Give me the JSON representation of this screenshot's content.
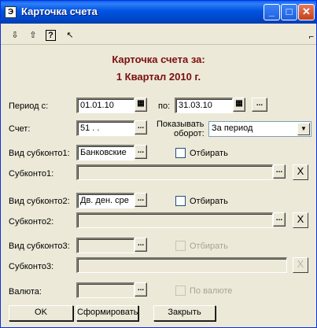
{
  "window": {
    "title": "Карточка счета",
    "minimize": "_",
    "maximize": "□",
    "close": "✕"
  },
  "heading": {
    "line1": "Карточка счета за:",
    "line2": "1 Квартал 2010 г."
  },
  "period": {
    "from_label": "Период с:",
    "from_value": "01.01.10",
    "to_label": "по:",
    "to_value": "31.03.10",
    "more_button": "..."
  },
  "account": {
    "label": "Счет:",
    "value": "51 .  .",
    "show_turnover_label_1": "Показывать",
    "show_turnover_label_2": "оборот:",
    "turnover_value": "За период"
  },
  "subconto1": {
    "kind_label": "Вид субконто1:",
    "kind_value": "Банковские",
    "filter_label": "Отбирать",
    "label": "Субконто1:",
    "value": ""
  },
  "subconto2": {
    "kind_label": "Вид субконто2:",
    "kind_value": "Дв. ден. сре",
    "filter_label": "Отбирать",
    "label": "Субконто2:",
    "value": ""
  },
  "subconto3": {
    "kind_label": "Вид субконто3:",
    "kind_value": "",
    "filter_label": "Отбирать",
    "label": "Субконто3:",
    "value": ""
  },
  "currency": {
    "label": "Валюта:",
    "value": "",
    "by_currency_label": "По валюте"
  },
  "buttons": {
    "ok": "OK",
    "build": "Сформировать",
    "close": "Закрыть"
  },
  "ellipsis": "...",
  "clear": "X"
}
